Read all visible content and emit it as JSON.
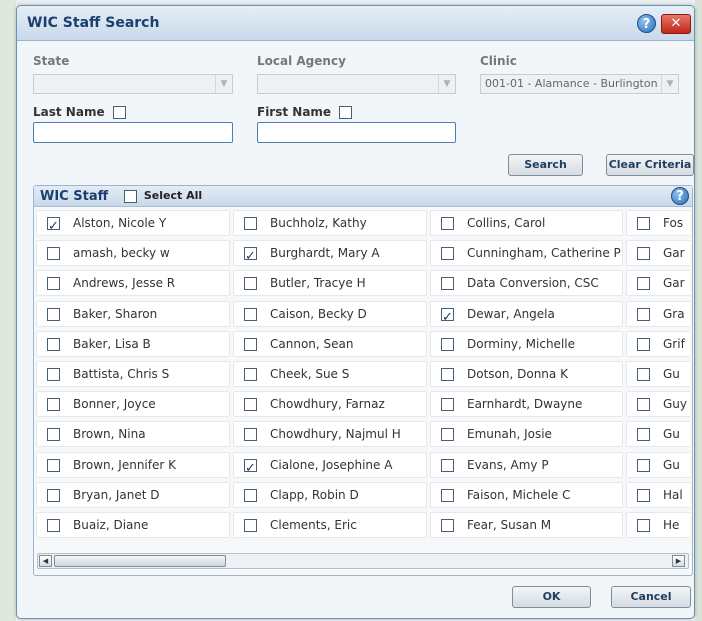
{
  "dialog": {
    "title": "WIC Staff Search",
    "help_glyph": "?",
    "close_glyph": "✕"
  },
  "filters": {
    "state": {
      "label": "State",
      "value": ""
    },
    "local_agency": {
      "label": "Local Agency",
      "value": ""
    },
    "clinic": {
      "label": "Clinic",
      "value": "001-01 - Alamance - Burlington"
    },
    "last_name": {
      "label": "Last Name",
      "value": ""
    },
    "first_name": {
      "label": "First Name",
      "value": ""
    },
    "dropdown_glyph": "▼"
  },
  "buttons": {
    "search": "Search",
    "clear_criteria": "Clear Criteria",
    "ok": "OK",
    "cancel": "Cancel"
  },
  "staff_panel": {
    "title": "WIC Staff",
    "select_all_label": "Select All",
    "scroll_left_glyph": "◀",
    "scroll_right_glyph": "▶",
    "columns": [
      [
        {
          "name": "Alston, Nicole Y",
          "checked": true
        },
        {
          "name": "amash, becky w",
          "checked": false
        },
        {
          "name": "Andrews, Jesse R",
          "checked": false
        },
        {
          "name": "Baker, Sharon",
          "checked": false
        },
        {
          "name": "Baker, Lisa B",
          "checked": false
        },
        {
          "name": "Battista, Chris S",
          "checked": false
        },
        {
          "name": "Bonner, Joyce",
          "checked": false
        },
        {
          "name": "Brown, Nina",
          "checked": false
        },
        {
          "name": "Brown, Jennifer K",
          "checked": false
        },
        {
          "name": "Bryan, Janet D",
          "checked": false
        },
        {
          "name": "Buaiz, Diane",
          "checked": false
        }
      ],
      [
        {
          "name": "Buchholz, Kathy",
          "checked": false
        },
        {
          "name": "Burghardt, Mary A",
          "checked": true
        },
        {
          "name": "Butler, Tracye H",
          "checked": false
        },
        {
          "name": "Caison, Becky D",
          "checked": false
        },
        {
          "name": "Cannon, Sean",
          "checked": false
        },
        {
          "name": "Cheek, Sue S",
          "checked": false
        },
        {
          "name": "Chowdhury, Farnaz",
          "checked": false
        },
        {
          "name": "Chowdhury, Najmul H",
          "checked": false
        },
        {
          "name": "Cialone, Josephine A",
          "checked": true
        },
        {
          "name": "Clapp, Robin D",
          "checked": false
        },
        {
          "name": "Clements, Eric",
          "checked": false
        }
      ],
      [
        {
          "name": "Collins, Carol",
          "checked": false
        },
        {
          "name": "Cunningham, Catherine P",
          "checked": false
        },
        {
          "name": "Data Conversion, CSC",
          "checked": false
        },
        {
          "name": "Dewar, Angela",
          "checked": true
        },
        {
          "name": "Dorminy, Michelle",
          "checked": false
        },
        {
          "name": "Dotson, Donna K",
          "checked": false
        },
        {
          "name": "Earnhardt, Dwayne",
          "checked": false
        },
        {
          "name": "Emunah, Josie",
          "checked": false
        },
        {
          "name": "Evans, Amy P",
          "checked": false
        },
        {
          "name": "Faison, Michele C",
          "checked": false
        },
        {
          "name": "Fear, Susan M",
          "checked": false
        }
      ],
      [
        {
          "name": "Fos",
          "checked": false
        },
        {
          "name": "Gar",
          "checked": false
        },
        {
          "name": "Gar",
          "checked": false
        },
        {
          "name": "Gra",
          "checked": false
        },
        {
          "name": "Grif",
          "checked": false
        },
        {
          "name": "Gu",
          "checked": false
        },
        {
          "name": "Guy",
          "checked": false
        },
        {
          "name": "Gu",
          "checked": false
        },
        {
          "name": "Gu",
          "checked": false
        },
        {
          "name": "Hal",
          "checked": false
        },
        {
          "name": "He",
          "checked": false
        }
      ]
    ]
  }
}
